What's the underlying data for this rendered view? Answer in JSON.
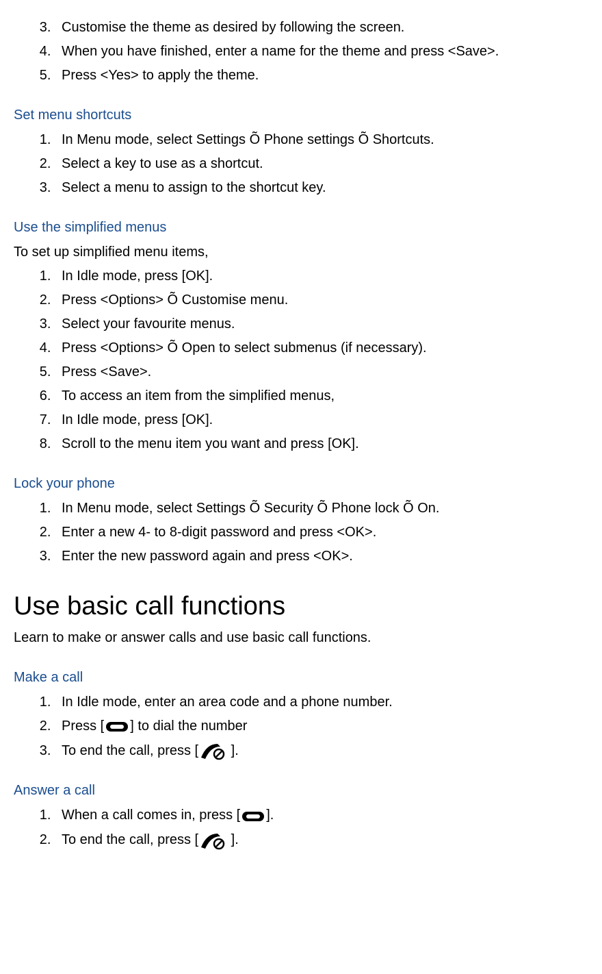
{
  "top_list": {
    "start": 3,
    "items": [
      "Customise the theme as desired by following the screen.",
      "When you have finished, enter a name for the theme and press <Save>.",
      "Press <Yes> to apply the theme."
    ]
  },
  "sections": {
    "shortcuts": {
      "heading": "Set menu shortcuts",
      "items": [
        "In Menu mode, select Settings Õ Phone settings Õ Shortcuts.",
        "Select a key to use as a shortcut.",
        "Select a menu to assign to the shortcut key."
      ]
    },
    "simplified": {
      "heading": "Use the simplified menus",
      "intro": "To set up simplified menu items,",
      "items": [
        "In Idle mode, press [OK].",
        "Press <Options> Õ Customise menu.",
        "Select your favourite menus.",
        "Press <Options> Õ Open to select submenus (if necessary).",
        "Press <Save>.",
        "To access an item from the simplified menus,",
        "In Idle mode, press [OK].",
        "Scroll to the menu item you want and press [OK]."
      ]
    },
    "lock": {
      "heading": "Lock your phone",
      "items": [
        "In Menu mode, select Settings Õ Security Õ Phone lock Õ On.",
        "Enter a new 4- to 8-digit password and press <OK>.",
        "Enter the new password again and press <OK>."
      ]
    },
    "basic_calls": {
      "heading": "Use basic call functions",
      "intro": "Learn to make or answer calls and use basic call functions."
    },
    "make_call": {
      "heading": "Make a call",
      "item1": "In Idle mode, enter an area code and a phone number.",
      "item2_pre": "Press [",
      "item2_post": "] to dial the number",
      "item3_pre": "To end the call, press [",
      "item3_post": " ]."
    },
    "answer_call": {
      "heading": "Answer a call",
      "item1_pre": "When a call comes in, press [",
      "item1_post": "].",
      "item2_pre": "To end the call, press [",
      "item2_post": " ]."
    }
  }
}
